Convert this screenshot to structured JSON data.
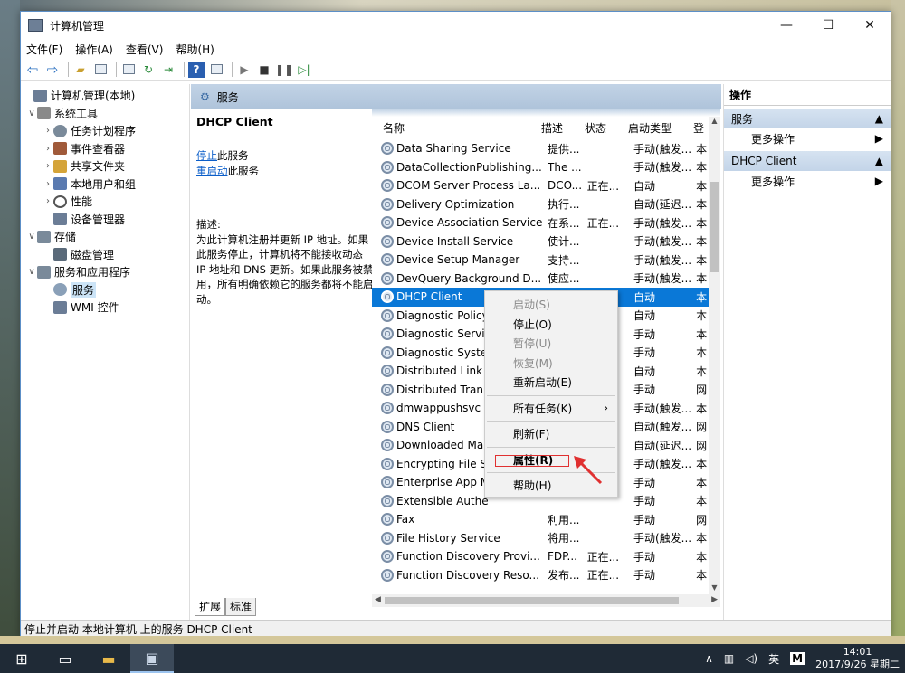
{
  "window": {
    "title": "计算机管理",
    "controls": [
      "—",
      "☐",
      "✕"
    ]
  },
  "menu": [
    "文件(F)",
    "操作(A)",
    "查看(V)",
    "帮助(H)"
  ],
  "tree": [
    {
      "label": "计算机管理(本地)",
      "level": 0,
      "toggle": "",
      "color": "#6b7d96"
    },
    {
      "label": "系统工具",
      "level": 1,
      "toggle": "∨",
      "color": "#8a8a8a"
    },
    {
      "label": "任务计划程序",
      "level": 2,
      "toggle": "›",
      "color": "#7a8a9a"
    },
    {
      "label": "事件查看器",
      "level": 2,
      "toggle": "›",
      "color": "#a05a3a"
    },
    {
      "label": "共享文件夹",
      "level": 2,
      "toggle": "›",
      "color": "#d4a43a"
    },
    {
      "label": "本地用户和组",
      "level": 2,
      "toggle": "›",
      "color": "#5a7ab0"
    },
    {
      "label": "性能",
      "level": 2,
      "toggle": "›",
      "color": "#c0392b"
    },
    {
      "label": "设备管理器",
      "level": 2,
      "toggle": "",
      "color": "#6b7d96"
    },
    {
      "label": "存储",
      "level": 1,
      "toggle": "∨",
      "color": "#7a8a9a"
    },
    {
      "label": "磁盘管理",
      "level": 2,
      "toggle": "",
      "color": "#5a6a7a"
    },
    {
      "label": "服务和应用程序",
      "level": 1,
      "toggle": "∨",
      "color": "#7a8a9a"
    },
    {
      "label": "服务",
      "level": 2,
      "toggle": "",
      "color": "#8aa0b8",
      "selected": true
    },
    {
      "label": "WMI 控件",
      "level": 2,
      "toggle": "",
      "color": "#6b7d96"
    }
  ],
  "center": {
    "header": "服务",
    "service_name": "DHCP Client",
    "stop_link": "停止",
    "stop_suffix": "此服务",
    "restart_link": "重启动",
    "restart_suffix": "此服务",
    "desc_label": "描述:",
    "desc_text": "为此计算机注册并更新 IP 地址。如果此服务停止，计算机将不能接收动态 IP 地址和 DNS 更新。如果此服务被禁用，所有明确依赖它的服务都将不能启动。"
  },
  "columns": [
    "名称",
    "描述",
    "状态",
    "启动类型",
    "登"
  ],
  "services": [
    {
      "name": "Data Sharing Service",
      "desc": "提供...",
      "status": "",
      "startup": "手动(触发...",
      "logon": "本"
    },
    {
      "name": "DataCollectionPublishing...",
      "desc": "The ...",
      "status": "",
      "startup": "手动(触发...",
      "logon": "本"
    },
    {
      "name": "DCOM Server Process La...",
      "desc": "DCO...",
      "status": "正在...",
      "startup": "自动",
      "logon": "本"
    },
    {
      "name": "Delivery Optimization",
      "desc": "执行...",
      "status": "",
      "startup": "自动(延迟...",
      "logon": "本"
    },
    {
      "name": "Device Association Service",
      "desc": "在系...",
      "status": "正在...",
      "startup": "手动(触发...",
      "logon": "本"
    },
    {
      "name": "Device Install Service",
      "desc": "使计...",
      "status": "",
      "startup": "手动(触发...",
      "logon": "本"
    },
    {
      "name": "Device Setup Manager",
      "desc": "支持...",
      "status": "",
      "startup": "手动(触发...",
      "logon": "本"
    },
    {
      "name": "DevQuery Background D...",
      "desc": "使应...",
      "status": "",
      "startup": "手动(触发...",
      "logon": "本"
    },
    {
      "name": "DHCP Client",
      "desc": "为此...",
      "status": "正在...",
      "startup": "自动",
      "logon": "本",
      "selected": true
    },
    {
      "name": "Diagnostic Policy",
      "desc": "",
      "status": "",
      "startup": "自动",
      "logon": "本"
    },
    {
      "name": "Diagnostic Servi",
      "desc": "",
      "status": "",
      "startup": "手动",
      "logon": "本"
    },
    {
      "name": "Diagnostic Syste",
      "desc": "",
      "status": "",
      "startup": "手动",
      "logon": "本"
    },
    {
      "name": "Distributed Link",
      "desc": "",
      "status": "",
      "startup": "自动",
      "logon": "本"
    },
    {
      "name": "Distributed Tran",
      "desc": "",
      "status": "",
      "startup": "手动",
      "logon": "网"
    },
    {
      "name": "dmwappushsvc",
      "desc": "",
      "status": "",
      "startup": "手动(触发...",
      "logon": "本"
    },
    {
      "name": "DNS Client",
      "desc": "",
      "status": "",
      "startup": "自动(触发...",
      "logon": "网"
    },
    {
      "name": "Downloaded Ma",
      "desc": "",
      "status": "",
      "startup": "自动(延迟...",
      "logon": "网"
    },
    {
      "name": "Encrypting File S",
      "desc": "",
      "status": "",
      "startup": "手动(触发...",
      "logon": "本"
    },
    {
      "name": "Enterprise App M",
      "desc": "",
      "status": "",
      "startup": "手动",
      "logon": "本"
    },
    {
      "name": "Extensible Authe",
      "desc": "",
      "status": "",
      "startup": "手动",
      "logon": "本"
    },
    {
      "name": "Fax",
      "desc": "利用...",
      "status": "",
      "startup": "手动",
      "logon": "网"
    },
    {
      "name": "File History Service",
      "desc": "将用...",
      "status": "",
      "startup": "手动(触发...",
      "logon": "本"
    },
    {
      "name": "Function Discovery Provi...",
      "desc": "FDP...",
      "status": "正在...",
      "startup": "手动",
      "logon": "本"
    },
    {
      "name": "Function Discovery Reso...",
      "desc": "发布...",
      "status": "正在...",
      "startup": "手动",
      "logon": "本"
    }
  ],
  "tabs": [
    "扩展",
    "标准"
  ],
  "actions": {
    "title": "操作",
    "sections": [
      {
        "label": "服务",
        "item": "更多操作"
      },
      {
        "label": "DHCP Client",
        "item": "更多操作"
      }
    ]
  },
  "context_menu": [
    {
      "label": "启动(S)",
      "disabled": true
    },
    {
      "label": "停止(O)",
      "disabled": false
    },
    {
      "label": "暂停(U)",
      "disabled": true
    },
    {
      "label": "恢复(M)",
      "disabled": true
    },
    {
      "label": "重新启动(E)",
      "disabled": false
    },
    {
      "sep": true
    },
    {
      "label": "所有任务(K)",
      "disabled": false,
      "submenu": true
    },
    {
      "sep": true
    },
    {
      "label": "刷新(F)",
      "disabled": false
    },
    {
      "sep": true
    },
    {
      "label": "属性(R)",
      "disabled": false,
      "bold": true
    },
    {
      "sep": true
    },
    {
      "label": "帮助(H)",
      "disabled": false
    }
  ],
  "status_bar": "停止并启动 本地计算机 上的服务 DHCP Client",
  "taskbar": {
    "input_lang": "英",
    "ime": "M",
    "time": "14:01",
    "date": "2017/9/26 星期二"
  },
  "colors": {
    "selection": "#0a78d7",
    "link": "#0b5ec9",
    "header_band": "#aec3da",
    "annotation": "#e03030"
  }
}
